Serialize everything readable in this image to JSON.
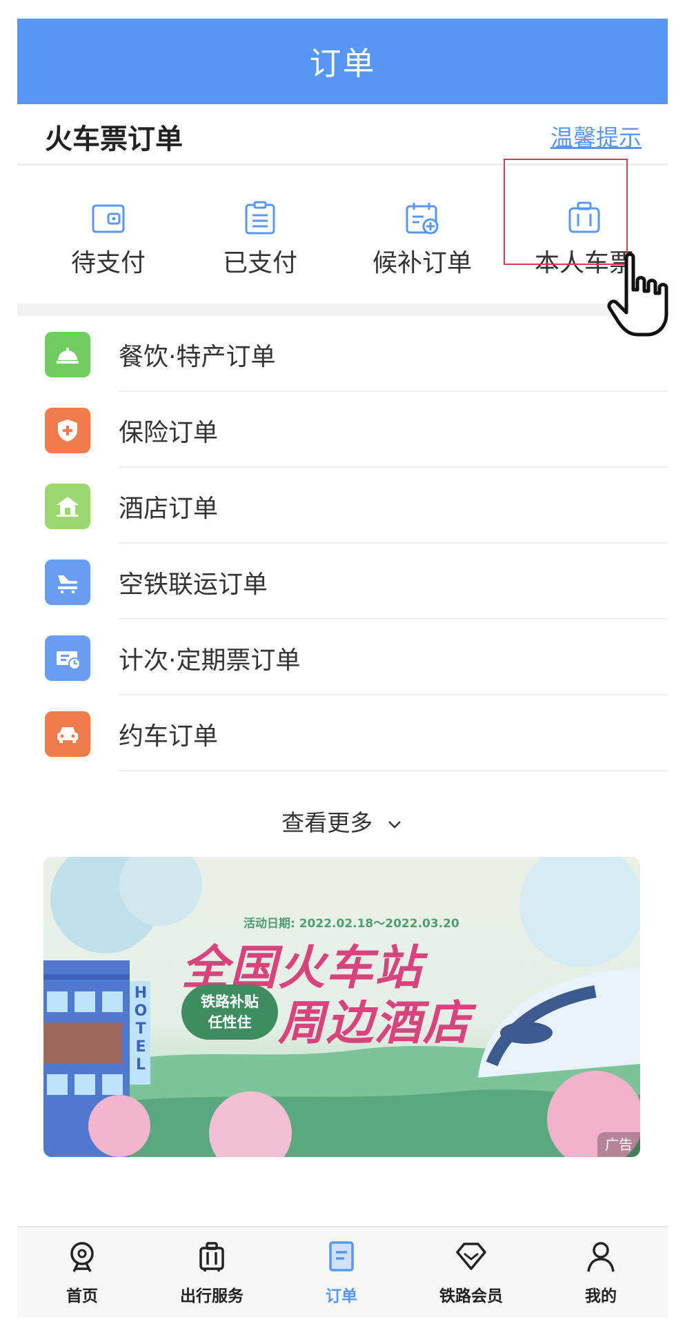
{
  "header": {
    "title": "订单"
  },
  "section": {
    "title": "火车票订单",
    "tips_link": "温馨提示"
  },
  "quick_entries": [
    {
      "label": "待支付",
      "icon": "wallet-icon"
    },
    {
      "label": "已支付",
      "icon": "clipboard-icon"
    },
    {
      "label": "候补订单",
      "icon": "calendar-add-icon"
    },
    {
      "label": "本人车票",
      "icon": "luggage-icon"
    }
  ],
  "order_list": [
    {
      "label": "餐饮·特产订单",
      "icon": "service-bell-icon",
      "color": "#6fcd5f"
    },
    {
      "label": "保险订单",
      "icon": "shield-plus-icon",
      "color": "#ee7d4b"
    },
    {
      "label": "酒店订单",
      "icon": "house-icon",
      "color": "#9ad86f"
    },
    {
      "label": "空铁联运订单",
      "icon": "plane-rail-icon",
      "color": "#6a9cf2"
    },
    {
      "label": "计次·定期票订单",
      "icon": "ticket-clock-icon",
      "color": "#6a9cf2"
    },
    {
      "label": "约车订单",
      "icon": "car-icon",
      "color": "#ee7d4b"
    }
  ],
  "more": {
    "label": "查看更多"
  },
  "banner": {
    "date": "活动日期: 2022.02.18～2022.03.20",
    "title_line1": "全国火车站",
    "title_line2": "周边酒店",
    "pill_line1": "铁路补贴",
    "pill_line2": "任性住",
    "hotel_sign": "HOTEL",
    "ad_label": "广告"
  },
  "tabbar": {
    "items": [
      {
        "label": "首页",
        "icon": "train-home-icon",
        "active": false
      },
      {
        "label": "出行服务",
        "icon": "suitcase-icon",
        "active": false
      },
      {
        "label": "订单",
        "icon": "document-icon",
        "active": true
      },
      {
        "label": "铁路会员",
        "icon": "diamond-icon",
        "active": false
      },
      {
        "label": "我的",
        "icon": "person-icon",
        "active": false
      }
    ]
  },
  "colors": {
    "primary": "#5896f3",
    "highlight_border": "#d83a50"
  }
}
